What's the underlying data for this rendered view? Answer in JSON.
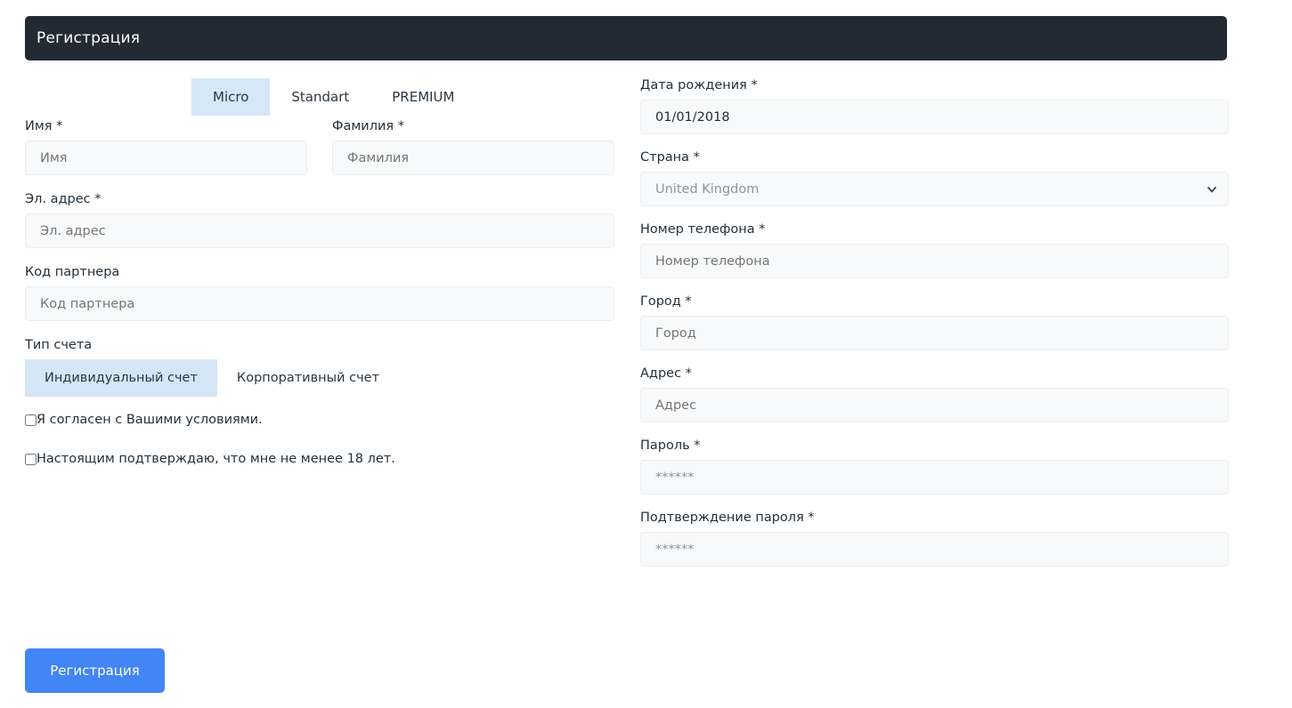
{
  "header": {
    "title": "Регистрация"
  },
  "plans": {
    "tabs": [
      {
        "label": "Micro",
        "active": true
      },
      {
        "label": "Standart",
        "active": false
      },
      {
        "label": "PREMIUM",
        "active": false
      }
    ]
  },
  "left": {
    "first_name": {
      "label": "Имя *",
      "placeholder": "Имя",
      "value": ""
    },
    "last_name": {
      "label": "Фамилия *",
      "placeholder": "Фамилия",
      "value": ""
    },
    "email": {
      "label": "Эл. адрес *",
      "placeholder": "Эл. адрес",
      "value": ""
    },
    "partner_code": {
      "label": "Код партнера",
      "placeholder": "Код партнера",
      "value": ""
    },
    "account_type": {
      "label": "Тип счета",
      "options": [
        {
          "label": "Индивидуальный счет",
          "active": true
        },
        {
          "label": "Корпоративный счет",
          "active": false
        }
      ]
    },
    "terms_checkbox": {
      "label": "Я согласен с Вашими условиями.",
      "checked": false
    },
    "age_checkbox": {
      "label": "Настоящим подтверждаю, что мне не менее 18 лет.",
      "checked": false
    }
  },
  "right": {
    "birth_date": {
      "label": "Дата рождения *",
      "value": "01/01/2018"
    },
    "country": {
      "label": "Страна *",
      "value": "United Kingdom"
    },
    "phone": {
      "label": "Номер телефона *",
      "placeholder": "Номер телефона",
      "value": ""
    },
    "city": {
      "label": "Город *",
      "placeholder": "Город",
      "value": ""
    },
    "address": {
      "label": "Адрес *",
      "placeholder": "Адрес",
      "value": ""
    },
    "password": {
      "label": "Пароль *",
      "value": "******"
    },
    "password_confirm": {
      "label": "Подтверждение пароля *",
      "value": "******"
    }
  },
  "submit": {
    "label": "Регистрация"
  },
  "colors": {
    "header_bg": "#222b33",
    "accent_button": "#4285f4",
    "tab_active_bg": "#d6e7f8",
    "toggle_active_bg": "#d4e6f7",
    "input_bg": "#f8f9fa"
  }
}
